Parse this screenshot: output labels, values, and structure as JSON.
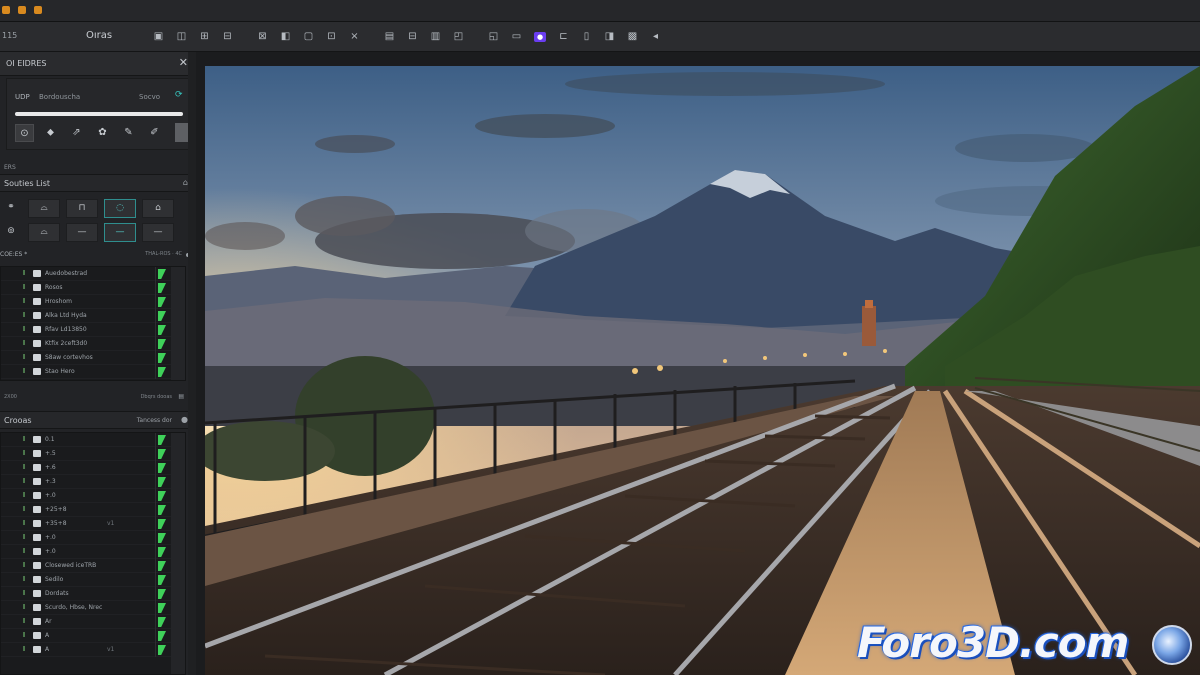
{
  "window": {
    "toolbar_left_label": "115",
    "title": "Oıras"
  },
  "toolbar": {
    "tools": [
      "▣",
      "◫",
      "⊞",
      "⊟",
      "⊠",
      "◧",
      "▢",
      "⊡",
      "×",
      "▤",
      "⊟",
      "▥",
      "◰",
      "◱",
      "▭",
      "●",
      "⊏",
      "▯",
      "◨",
      "▩",
      "◂"
    ]
  },
  "panel": {
    "title": "OI EIDRES",
    "tool_box": {
      "label_a": "UDP",
      "label_b": "Bordouscha",
      "label_c": "Socvo",
      "icons": [
        "⊙",
        "⬥",
        "⇗",
        "✿",
        "✎",
        "✐"
      ]
    },
    "small_label_1": "ERS",
    "section1": {
      "title": "Souties List"
    },
    "btn_row1": [
      "⚭",
      "⌓",
      "⊓",
      "◌",
      "⌂"
    ],
    "btn_row2": [
      "⊚",
      "⌓",
      "—",
      "—",
      "—"
    ],
    "list1": {
      "header": "COE:ES *",
      "header_right": "THAL-ROS · 4C",
      "items": [
        {
          "name": "Auedobestrad"
        },
        {
          "name": "Rosos"
        },
        {
          "name": "Hroshom"
        },
        {
          "name": "Alka Ltd Hyda"
        },
        {
          "name": "Rfav Ld13850"
        },
        {
          "name": "Ktfix 2ceft3d0"
        },
        {
          "name": "S8aw cortevhos"
        },
        {
          "name": "Stao Hero"
        }
      ],
      "footer_left": "2X00",
      "footer_right": "Dbqrs dooas"
    },
    "section2": {
      "title": "Crooas",
      "right": "Tancess dor"
    },
    "list2": {
      "items": [
        {
          "name": "0.1",
          "extra": ""
        },
        {
          "name": "+.5",
          "extra": ""
        },
        {
          "name": "+.6",
          "extra": ""
        },
        {
          "name": "+.3",
          "extra": ""
        },
        {
          "name": "+.0",
          "extra": ""
        },
        {
          "name": "+25+8",
          "extra": ""
        },
        {
          "name": "+35+8",
          "extra": "v1"
        },
        {
          "name": "+.0",
          "extra": ""
        },
        {
          "name": "+.0",
          "extra": ""
        },
        {
          "name": "Closewed iceTRB",
          "extra": ""
        },
        {
          "name": "Sedilo",
          "extra": ""
        },
        {
          "name": "Dordats",
          "extra": ""
        },
        {
          "name": "Scurdo, Hbse, Nrec",
          "extra": ""
        },
        {
          "name": "Ar",
          "extra": ""
        },
        {
          "name": "A",
          "extra": ""
        },
        {
          "name": "A",
          "extra": "v1"
        }
      ]
    }
  },
  "viewport": {
    "scene": "photo"
  },
  "watermark": {
    "text": "Foro3D.com",
    "logo": "globe-logo"
  },
  "colors": {
    "accent": "#6a3df0",
    "flag": "#3fd15a",
    "teal": "#37c7c0"
  }
}
